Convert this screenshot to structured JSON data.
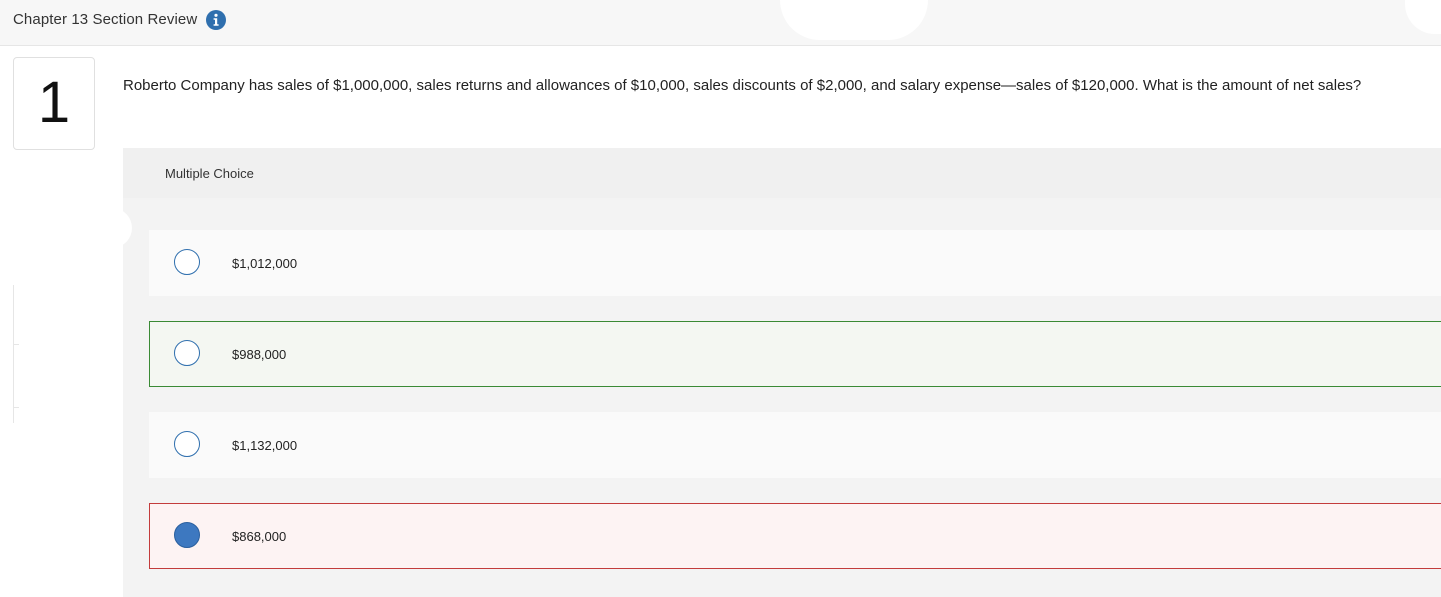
{
  "header": {
    "title": "Chapter 13 Section Review",
    "info_icon": "info-icon",
    "accent_color": "#2f6fae"
  },
  "question": {
    "number": "1",
    "text": "Roberto Company has sales of $1,000,000, sales returns and allowances of $10,000, sales discounts of $2,000, and salary expense—sales of $120,000. What is the amount of net sales?"
  },
  "multiple_choice": {
    "label": "Multiple Choice",
    "options": [
      {
        "label": "$1,012,000",
        "selected": false,
        "status": "none"
      },
      {
        "label": "$988,000",
        "selected": false,
        "status": "correct"
      },
      {
        "label": "$1,132,000",
        "selected": false,
        "status": "none"
      },
      {
        "label": "$868,000",
        "selected": true,
        "status": "incorrect"
      }
    ]
  },
  "colors": {
    "correct_border": "#3a8a35",
    "incorrect_border": "#c33b3b",
    "selected_radio": "#3d78c0"
  }
}
